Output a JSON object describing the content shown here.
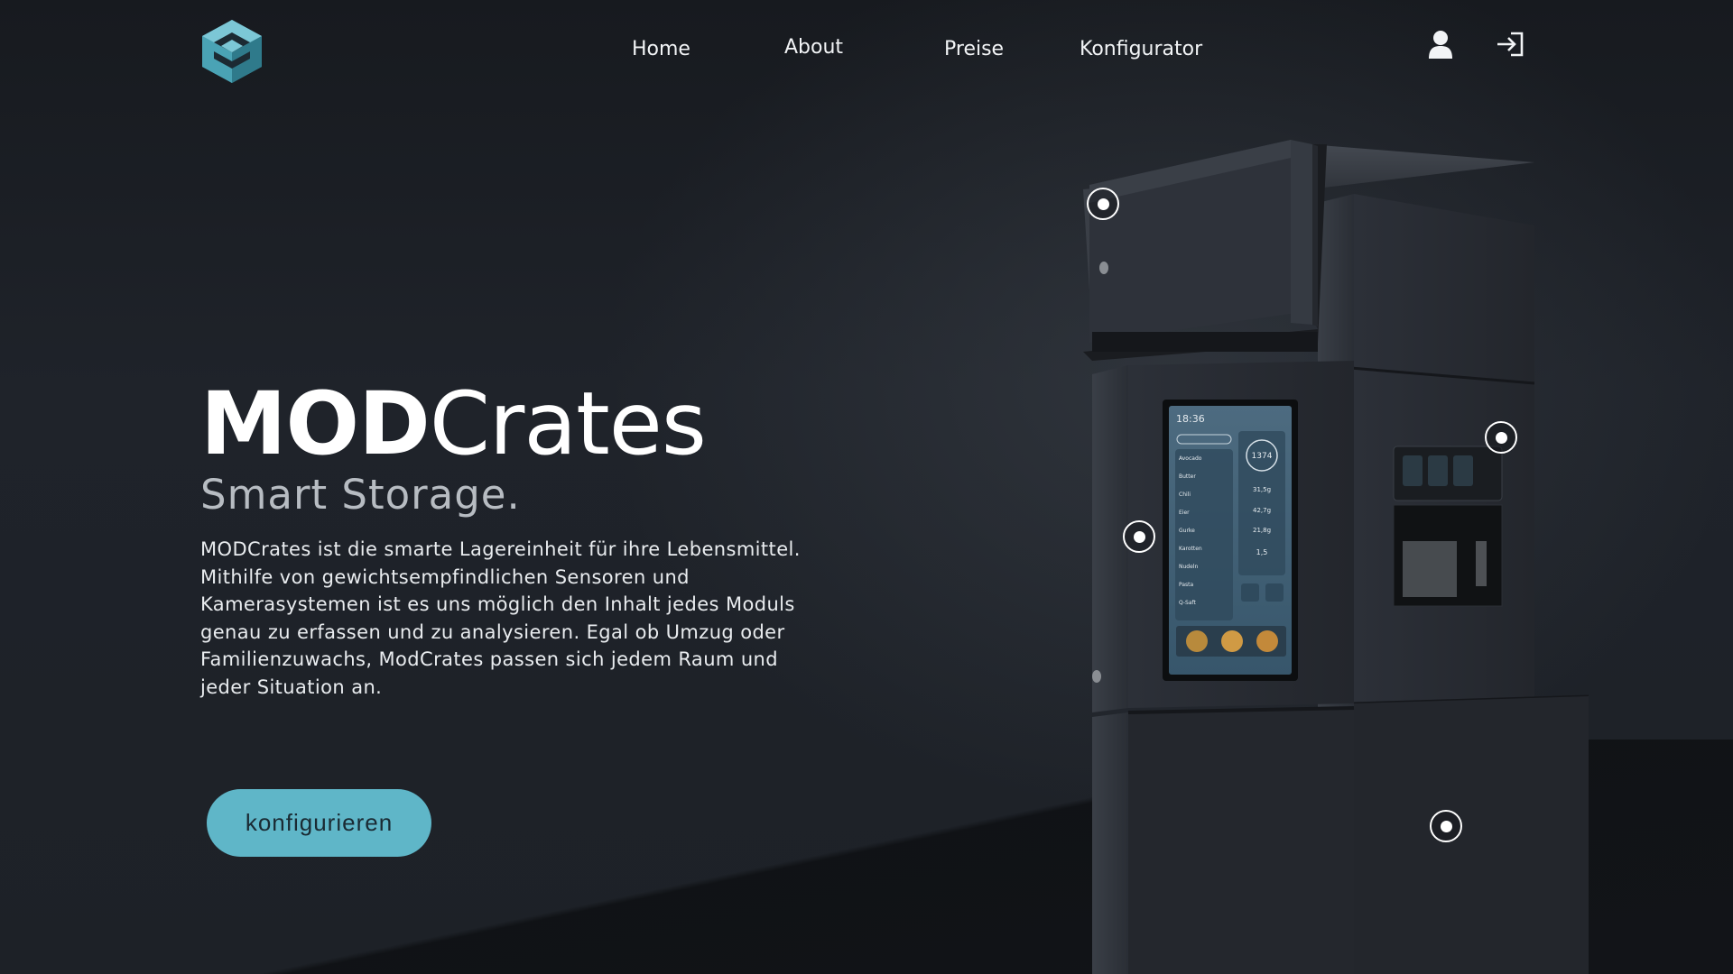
{
  "brand": {
    "logo_icon": "modcrates-cube-logo-icon",
    "accent_color": "#5fb6c8"
  },
  "nav": {
    "items": [
      {
        "label": "Home"
      },
      {
        "label": "About"
      },
      {
        "label": "Preise"
      },
      {
        "label": "Konfigurator"
      }
    ],
    "user_icon": "user-icon",
    "login_icon": "login-icon"
  },
  "hero": {
    "title_bold": "MOD",
    "title_light": "Crates",
    "subtitle": "Smart Storage.",
    "description": "MODCrates ist die smarte Lagereinheit für ihre Lebensmittel. Mithilfe von gewichtsempfindlichen Sensoren und Kamerasystemen ist es uns möglich den Inhalt jedes Moduls genau zu erfassen und zu analysieren. Egal ob Umzug oder Familienzuwachs, ModCrates passen sich jedem Raum und jeder Situation an.",
    "cta_label": "konfigurieren"
  },
  "device_screen": {
    "time": "18:36",
    "center_value": "1374",
    "stat_1": "31,5g",
    "stat_2": "42,7g",
    "stat_3": "21,8g",
    "water": "1,5",
    "items": [
      "Avocado",
      "Butter",
      "Chili",
      "Eier",
      "Gurke",
      "Karotten",
      "Nudeln",
      "Pasta",
      "Q-Saft"
    ]
  }
}
